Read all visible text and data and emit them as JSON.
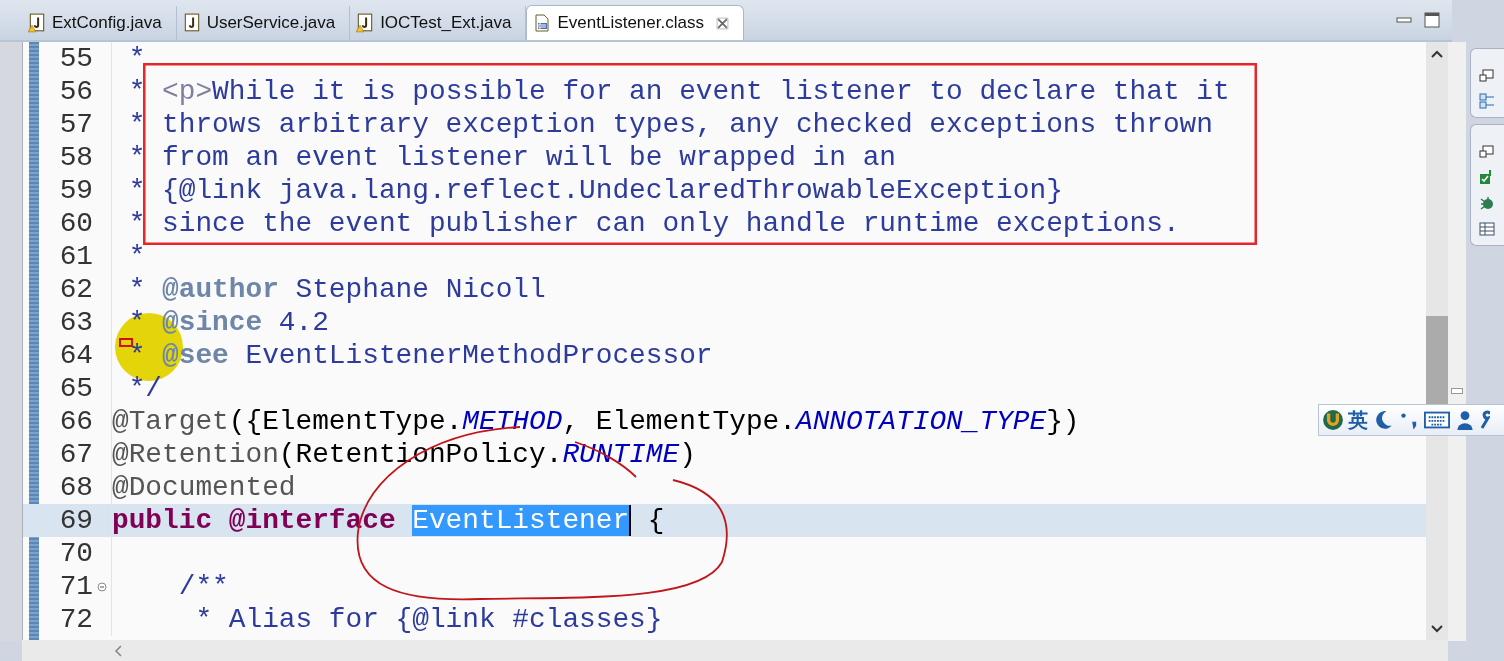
{
  "tabs": [
    {
      "label": "ExtConfig.java",
      "kind": "java-warning",
      "selected": false
    },
    {
      "label": "UserService.java",
      "kind": "java",
      "selected": false
    },
    {
      "label": "IOCTest_Ext.java",
      "kind": "java-warning",
      "selected": false
    },
    {
      "label": "EventListener.class",
      "kind": "class",
      "selected": true
    }
  ],
  "lines": [
    {
      "number": "55",
      "fold_marker": false,
      "current": false,
      "tokens": [
        {
          "t": " *",
          "kind": "comment"
        }
      ]
    },
    {
      "number": "56",
      "fold_marker": false,
      "current": false,
      "tokens": [
        {
          "t": " * ",
          "kind": "comment"
        },
        {
          "t": "<p>",
          "kind": "html"
        },
        {
          "t": "While it is possible for an event listener to declare that it",
          "kind": "comment"
        }
      ]
    },
    {
      "number": "57",
      "fold_marker": false,
      "current": false,
      "tokens": [
        {
          "t": " * throws arbitrary exception types, any checked exceptions thrown",
          "kind": "comment"
        }
      ]
    },
    {
      "number": "58",
      "fold_marker": false,
      "current": false,
      "tokens": [
        {
          "t": " * from an event listener will be wrapped in an",
          "kind": "comment"
        }
      ]
    },
    {
      "number": "59",
      "fold_marker": false,
      "current": false,
      "tokens": [
        {
          "t": " * {@link java.lang.reflect.UndeclaredThrowableException}",
          "kind": "comment"
        }
      ]
    },
    {
      "number": "60",
      "fold_marker": false,
      "current": false,
      "tokens": [
        {
          "t": " * since the event publisher can only handle runtime exceptions.",
          "kind": "comment"
        }
      ]
    },
    {
      "number": "61",
      "fold_marker": false,
      "current": false,
      "tokens": [
        {
          "t": " *",
          "kind": "comment"
        }
      ]
    },
    {
      "number": "62",
      "fold_marker": false,
      "current": false,
      "tokens": [
        {
          "t": " * ",
          "kind": "comment"
        },
        {
          "t": "@author",
          "kind": "doctag"
        },
        {
          "t": " Stephane Nicoll",
          "kind": "comment"
        }
      ]
    },
    {
      "number": "63",
      "fold_marker": false,
      "current": false,
      "tokens": [
        {
          "t": " * ",
          "kind": "comment"
        },
        {
          "t": "@since",
          "kind": "doctag"
        },
        {
          "t": " 4.2",
          "kind": "comment"
        }
      ]
    },
    {
      "number": "64",
      "fold_marker": false,
      "current": false,
      "tokens": [
        {
          "t": " * ",
          "kind": "comment"
        },
        {
          "t": "@see",
          "kind": "doctag"
        },
        {
          "t": " EventListenerMethodProcessor",
          "kind": "comment"
        }
      ]
    },
    {
      "number": "65",
      "fold_marker": false,
      "current": false,
      "tokens": [
        {
          "t": " */",
          "kind": "comment"
        }
      ]
    },
    {
      "number": "66",
      "fold_marker": false,
      "current": false,
      "tokens": [
        {
          "t": "@Target",
          "kind": "annotation"
        },
        {
          "t": "({ElementType.",
          "kind": "plain"
        },
        {
          "t": "METHOD",
          "kind": "constant"
        },
        {
          "t": ", ElementType.",
          "kind": "plain"
        },
        {
          "t": "ANNOTATION_TYPE",
          "kind": "constant"
        },
        {
          "t": "})",
          "kind": "plain"
        }
      ]
    },
    {
      "number": "67",
      "fold_marker": false,
      "current": false,
      "tokens": [
        {
          "t": "@Retention",
          "kind": "annotation"
        },
        {
          "t": "(RetentionPolicy.",
          "kind": "plain"
        },
        {
          "t": "RUNTIME",
          "kind": "constant"
        },
        {
          "t": ")",
          "kind": "plain"
        }
      ]
    },
    {
      "number": "68",
      "fold_marker": false,
      "current": false,
      "tokens": [
        {
          "t": "@Documented",
          "kind": "annotation"
        }
      ]
    },
    {
      "number": "69",
      "fold_marker": false,
      "current": true,
      "tokens": [
        {
          "t": "public @interface",
          "kind": "keyword"
        },
        {
          "t": "EventListener",
          "kind": "selected"
        },
        {
          "t": " {",
          "kind": "plain"
        }
      ]
    },
    {
      "number": "70",
      "fold_marker": false,
      "current": false
    },
    {
      "number": "71",
      "fold_marker": true,
      "current": false,
      "tokens": [
        {
          "t": "    /**",
          "kind": "comment"
        }
      ]
    },
    {
      "number": "72",
      "fold_marker": false,
      "current": false,
      "tokens": [
        {
          "t": "     * Alias for {@link #classes}",
          "kind": "comment"
        }
      ]
    }
  ],
  "ime_bar": {
    "mode": "英"
  }
}
